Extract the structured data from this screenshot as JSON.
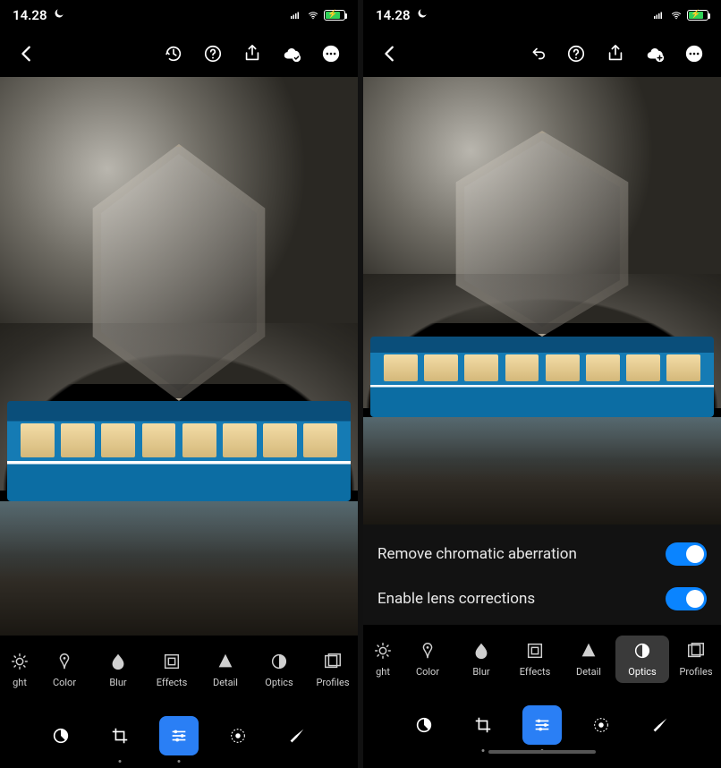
{
  "statusBar": {
    "time": "14.28"
  },
  "left": {
    "adjust": {
      "light": "ght",
      "color": "Color",
      "blur": "Blur",
      "effects": "Effects",
      "detail": "Detail",
      "optics": "Optics",
      "profiles": "Profiles"
    }
  },
  "right": {
    "optics": {
      "chromatic": "Remove chromatic aberration",
      "lens": "Enable lens corrections"
    },
    "adjust": {
      "light": "ght",
      "color": "Color",
      "blur": "Blur",
      "effects": "Effects",
      "detail": "Detail",
      "optics": "Optics",
      "profiles": "Profiles"
    }
  }
}
